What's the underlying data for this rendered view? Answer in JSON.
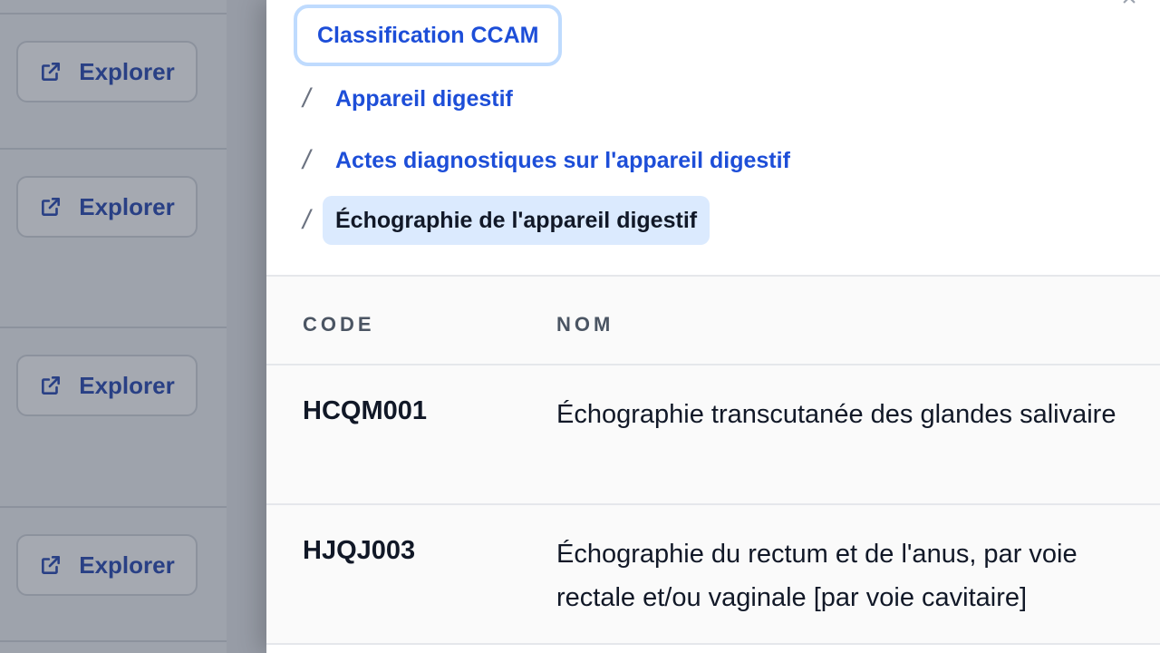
{
  "background": {
    "explore_buttons": [
      {
        "label": "Explorer"
      },
      {
        "label": "Explorer"
      },
      {
        "label": "Explorer"
      },
      {
        "label": "Explorer"
      }
    ]
  },
  "drawer": {
    "breadcrumb": {
      "root": "Classification CCAM",
      "separator": "/",
      "level1": "Appareil digestif",
      "level2": "Actes diagnostiques sur l'appareil digestif",
      "current": "Échographie de l'appareil digestif"
    },
    "table": {
      "headers": {
        "code": "CODE",
        "nom": "NOM"
      },
      "rows": [
        {
          "code": "HCQM001",
          "nom": "Échographie transcutanée des glandes salivaire"
        },
        {
          "code": "HJQJ003",
          "nom": "Échographie du rectum et de l'anus, par voie rectale et/ou vaginale [par voie cavitaire]"
        }
      ]
    }
  },
  "colors": {
    "link": "#1d4ed8",
    "current_bg": "#dbeafe",
    "focus_ring": "#bfdbfe",
    "explore_text": "#1e40af"
  },
  "icons": {
    "explore": "external-link-icon",
    "close": "close-icon"
  }
}
